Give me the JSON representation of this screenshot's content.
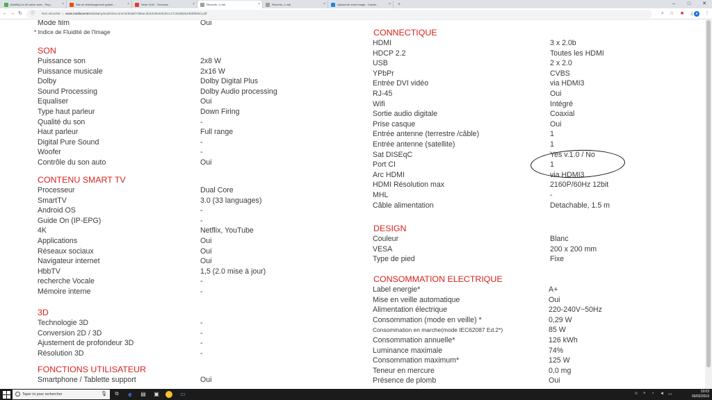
{
  "browser": {
    "tabs": [
      {
        "label": "[Wallfix] La 4K arrive avec - Rep...",
        "color": "#4caf50",
        "active": false
      },
      {
        "label": "Site de téléchargement gratuit ...",
        "color": "#e65100",
        "active": false
      },
      {
        "label": "Série Ch/Z - Thomson",
        "color": "#e53935",
        "active": false
      },
      {
        "label": "Records, 1 mdi",
        "color": "#9e9e9e",
        "active": true
      },
      {
        "label": "Records, 1 mdi",
        "color": "#9e9e9e",
        "active": false
      },
      {
        "label": "Upload de votre image - Casimi...",
        "color": "#1e88e5",
        "active": false
      }
    ],
    "new_tab_label": "+",
    "address": {
      "security": "Non sécurisé",
      "domain": "www.mediacenter.tcl.eu",
      "path": "/uploads/document/detail/7d68ac2b2d18040b4b1c17194d56523b5f6684.pdf"
    }
  },
  "document": {
    "top_rows": [
      {
        "label": "Mode film",
        "value": "Oui"
      },
      {
        "label": "* Indice de Fluidité de l'Image",
        "value": ""
      }
    ],
    "left_sections": [
      {
        "title": "SON",
        "rows": [
          {
            "label": "Puissance son",
            "value": "2x8 W"
          },
          {
            "label": "Puissance musicale",
            "value": "2x16 W"
          },
          {
            "label": "Dolby",
            "value": "Dolby Digital Plus"
          },
          {
            "label": "Sound Processing",
            "value": "Dolby Audio processing"
          },
          {
            "label": "Equaliser",
            "value": "Oui"
          },
          {
            "label": "Type haut parleur",
            "value": "Down Firing"
          },
          {
            "label": "Qualité du son",
            "value": "-"
          },
          {
            "label": "Haut parleur",
            "value": "Full range"
          },
          {
            "label": "Digital Pure Sound",
            "value": "-"
          },
          {
            "label": "Woofer",
            "value": "-"
          },
          {
            "label": "Contrôle du son auto",
            "value": "Oui"
          }
        ]
      },
      {
        "title": "CONTENU SMART TV",
        "rows": [
          {
            "label": "Processeur",
            "value": "Dual Core"
          },
          {
            "label": "SmartTV",
            "value": "3.0 (33 languages)"
          },
          {
            "label": "Android OS",
            "value": "-"
          },
          {
            "label": "Guide On (IP-EPG)",
            "value": "-"
          },
          {
            "label": "4K",
            "value": "Netflix, YouTube"
          },
          {
            "label": "Applications",
            "value": "Oui"
          },
          {
            "label": "Réseaux sociaux",
            "value": "Oui"
          },
          {
            "label": "Navigateur internet",
            "value": "Oui"
          },
          {
            "label": "HbbTV",
            "value": "1,5 (2.0 mise à jour)"
          },
          {
            "label": "recherche Vocale",
            "value": "-"
          },
          {
            "label": "Mémoire interne",
            "value": "-"
          }
        ]
      },
      {
        "title": "3D",
        "rows": [
          {
            "label": "Technologie 3D",
            "value": "-"
          },
          {
            "label": "Conversion 2D / 3D",
            "value": "-"
          },
          {
            "label": "Ajustement de profondeur 3D",
            "value": "-"
          },
          {
            "label": "Résolution 3D",
            "value": "-"
          }
        ]
      },
      {
        "title": "FONCTIONS UTILISATEUR",
        "rows": [
          {
            "label": "Smartphone / Tablette support",
            "value": "Oui"
          }
        ]
      }
    ],
    "right_sections": [
      {
        "title": "CONNECTIQUE",
        "rows": [
          {
            "label": "HDMI",
            "value": "3 x 2.0b"
          },
          {
            "label": "HDCP 2.2",
            "value": "Toutes les HDMI"
          },
          {
            "label": "USB",
            "value": "2 x 2.0"
          },
          {
            "label": "YPbPr",
            "value": "CVBS"
          },
          {
            "label": "Entrée DVI vidéo",
            "value": "via HDMI3"
          },
          {
            "label": "RJ-45",
            "value": "Oui"
          },
          {
            "label": "Wifi",
            "value": "Intégré"
          },
          {
            "label": "Sortie audio digitale",
            "value": "Coaxial"
          },
          {
            "label": "Prise casque",
            "value": "Oui"
          },
          {
            "label": "Entrée antenne (terrestre /câble)",
            "value": "1"
          },
          {
            "label": "Entrée antenne (satellite)",
            "value": "1"
          },
          {
            "label": "Sat DISEqC",
            "value": "Yes v.1.0 / No"
          },
          {
            "label": "Port CI",
            "value": "1"
          },
          {
            "label": "Arc HDMI",
            "value": "via HDMI3"
          },
          {
            "label": "HDMI Résolution max",
            "value": "2160P/60Hz 12bit"
          },
          {
            "label": "MHL",
            "value": "-"
          },
          {
            "label": "Câble alimentation",
            "value": "Detachable, 1.5 m"
          }
        ]
      },
      {
        "title": "DESIGN",
        "rows": [
          {
            "label": "Couleur",
            "value": "Blanc"
          },
          {
            "label": "VESA",
            "value": "200 x 200 mm"
          },
          {
            "label": "Type de pied",
            "value": "Fixe"
          }
        ]
      },
      {
        "title": "CONSOMMATION ELECTRIQUE",
        "rows": [
          {
            "label": "Label energie*",
            "value": "A+"
          },
          {
            "label": "Mise en veille automatique",
            "value": "Oui"
          },
          {
            "label": "Alimentation électrique",
            "value": "220-240V~50Hz"
          },
          {
            "label": "Consommation (mode en veille) *",
            "value": "0,29 W"
          },
          {
            "label": "Consommation en marche(mode IEC62087 Ed.2*)",
            "value": "85 W"
          },
          {
            "label": "Consommation annuelle*",
            "value": "126 kWh"
          },
          {
            "label": "Luminance maximale",
            "value": "74%"
          },
          {
            "label": "Consommation maximum*",
            "value": "125 W"
          },
          {
            "label": "Teneur en mercure",
            "value": "0,0 mg"
          },
          {
            "label": "Présence de plomb",
            "value": "Oui"
          }
        ]
      }
    ],
    "heading_color": "#d8211c",
    "text_color": "#3a3a3a"
  },
  "taskbar": {
    "search_placeholder": "Taper ici pour rechercher",
    "time": "19:03",
    "date": "03/02/2019"
  }
}
